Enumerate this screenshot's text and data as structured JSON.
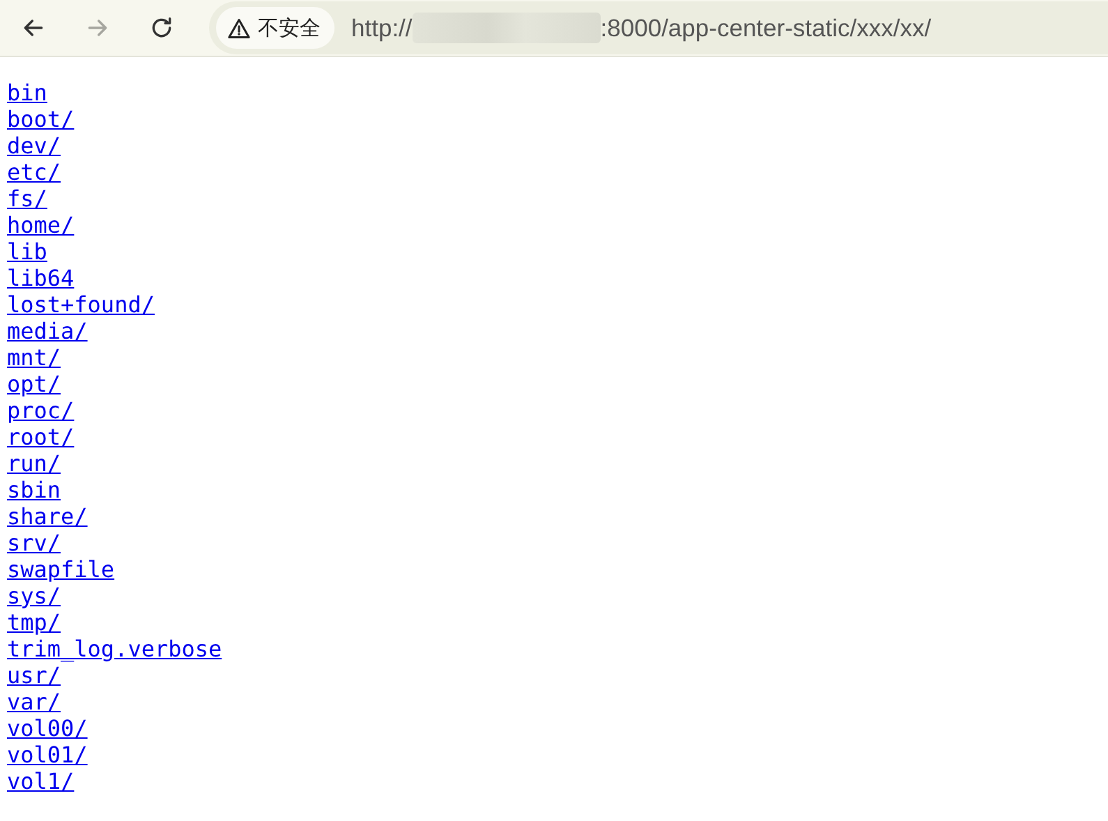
{
  "toolbar": {
    "buttons": [
      {
        "kind": "back",
        "disabled": false
      },
      {
        "kind": "forward",
        "disabled": true
      },
      {
        "kind": "reload",
        "disabled": false
      }
    ],
    "address_bar": {
      "security_label": "不安全",
      "url_start": "http://",
      "url_end": ":8000/app-center-static/xxx/xx/"
    }
  },
  "listing": [
    {
      "name": "bin"
    },
    {
      "name": "boot/"
    },
    {
      "name": "dev/"
    },
    {
      "name": "etc/"
    },
    {
      "name": "fs/"
    },
    {
      "name": "home/"
    },
    {
      "name": "lib"
    },
    {
      "name": "lib64"
    },
    {
      "name": "lost+found/"
    },
    {
      "name": "media/"
    },
    {
      "name": "mnt/"
    },
    {
      "name": "opt/"
    },
    {
      "name": "proc/"
    },
    {
      "name": "root/"
    },
    {
      "name": "run/"
    },
    {
      "name": "sbin"
    },
    {
      "name": "share/"
    },
    {
      "name": "srv/"
    },
    {
      "name": "swapfile"
    },
    {
      "name": "sys/"
    },
    {
      "name": "tmp/"
    },
    {
      "name": "trim_log.verbose"
    },
    {
      "name": "usr/"
    },
    {
      "name": "var/"
    },
    {
      "name": "vol00/"
    },
    {
      "name": "vol01/"
    },
    {
      "name": "vol1/"
    }
  ]
}
